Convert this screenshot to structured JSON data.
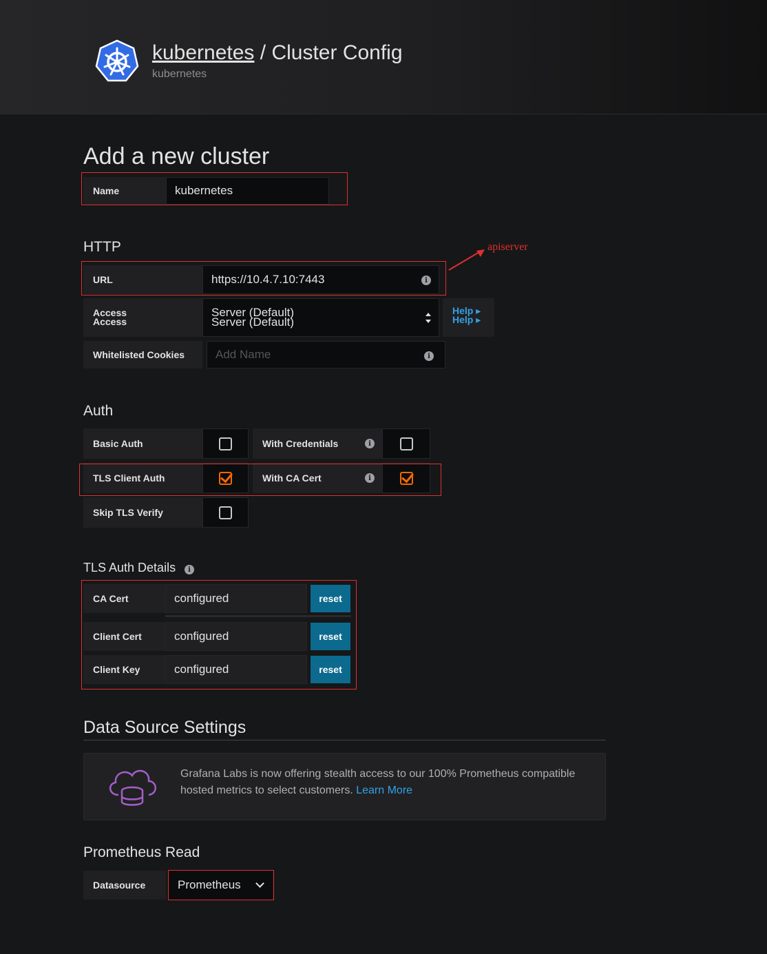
{
  "header": {
    "title_link": "kubernetes",
    "title_sep": " / ",
    "title_page": "Cluster Config",
    "subtitle": "kubernetes"
  },
  "heading": "Add a new cluster",
  "name": {
    "label": "Name",
    "value": "kubernetes"
  },
  "http": {
    "heading": "HTTP",
    "url": {
      "label": "URL",
      "value": "https://10.4.7.10:7443"
    },
    "access": {
      "label": "Access",
      "value": "Server (Default)"
    },
    "help": "Help",
    "cookies": {
      "label": "Whitelisted Cookies",
      "placeholder": "Add Name"
    }
  },
  "annotation": "apiserver",
  "auth": {
    "heading": "Auth",
    "basic_auth": {
      "label": "Basic Auth",
      "checked": false
    },
    "with_credentials": {
      "label": "With Credentials",
      "checked": false
    },
    "tls_client_auth": {
      "label": "TLS Client Auth",
      "checked": true
    },
    "with_ca_cert": {
      "label": "With CA Cert",
      "checked": true
    },
    "skip_tls_verify": {
      "label": "Skip TLS Verify",
      "checked": false
    }
  },
  "tls": {
    "heading": "TLS Auth Details",
    "rows": [
      {
        "label": "CA Cert",
        "value": "configured",
        "button": "reset"
      },
      {
        "label": "Client Cert",
        "value": "configured",
        "button": "reset"
      },
      {
        "label": "Client Key",
        "value": "configured",
        "button": "reset"
      }
    ]
  },
  "datasource_settings": {
    "heading": "Data Source Settings",
    "promo_text": "Grafana Labs is now offering stealth access to our 100% Prometheus compatible hosted metrics to select customers.",
    "promo_link": "Learn More"
  },
  "prometheus_read": {
    "heading": "Prometheus Read",
    "label": "Datasource",
    "value": "Prometheus"
  },
  "colors": {
    "accent": "#f46800",
    "link": "#33a2e5",
    "button": "#0c6a8e",
    "annotation": "#e0302f"
  }
}
